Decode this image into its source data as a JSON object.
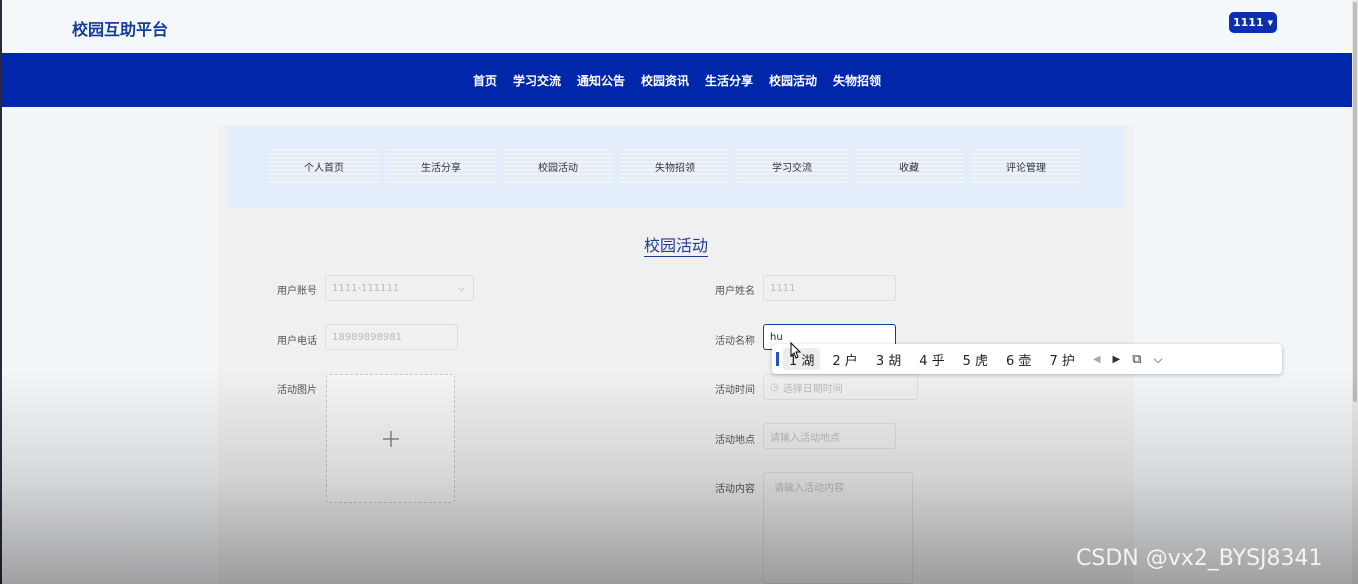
{
  "header": {
    "brand": "校园互助平台",
    "user_label": "1111"
  },
  "nav": [
    "首页",
    "学习交流",
    "通知公告",
    "校园资讯",
    "生活分享",
    "校园活动",
    "失物招领"
  ],
  "subnav": [
    "个人首页",
    "生活分享",
    "校园活动",
    "失物招领",
    "学习交流",
    "收藏",
    "评论管理"
  ],
  "page_title": "校园活动",
  "form": {
    "account_label": "用户账号",
    "account_value": "1111-111111",
    "name_label": "用户姓名",
    "name_value": "1111",
    "phone_label": "用户电话",
    "phone_value": "18989898981",
    "activity_name_label": "活动名称",
    "activity_name_value": "hu",
    "image_label": "活动图片",
    "upload_icon": "plus-icon",
    "time_label": "活动时间",
    "time_placeholder": "选择日期时间",
    "location_label": "活动地点",
    "location_placeholder": "请输入活动地点",
    "content_label": "活动内容",
    "content_placeholder": "请输入活动内容"
  },
  "ime": {
    "candidates": [
      "1 湖",
      "2 户",
      "3 胡",
      "4 乎",
      "5 虎",
      "6 壶",
      "7 护"
    ]
  },
  "watermark": "CSDN @vx2_BYSJ8341",
  "colors": {
    "primary": "#0027a9",
    "brand_text": "#163a9a"
  }
}
